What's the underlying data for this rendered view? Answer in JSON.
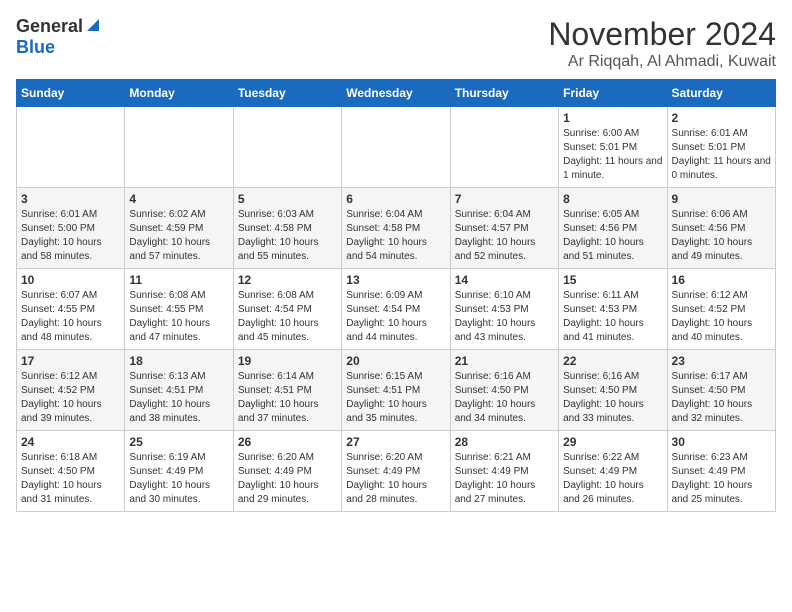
{
  "header": {
    "logo_general": "General",
    "logo_blue": "Blue",
    "month_title": "November 2024",
    "location": "Ar Riqqah, Al Ahmadi, Kuwait"
  },
  "weekdays": [
    "Sunday",
    "Monday",
    "Tuesday",
    "Wednesday",
    "Thursday",
    "Friday",
    "Saturday"
  ],
  "weeks": [
    [
      {
        "day": "",
        "sunrise": "",
        "sunset": "",
        "daylight": ""
      },
      {
        "day": "",
        "sunrise": "",
        "sunset": "",
        "daylight": ""
      },
      {
        "day": "",
        "sunrise": "",
        "sunset": "",
        "daylight": ""
      },
      {
        "day": "",
        "sunrise": "",
        "sunset": "",
        "daylight": ""
      },
      {
        "day": "",
        "sunrise": "",
        "sunset": "",
        "daylight": ""
      },
      {
        "day": "1",
        "sunrise": "Sunrise: 6:00 AM",
        "sunset": "Sunset: 5:01 PM",
        "daylight": "Daylight: 11 hours and 1 minute."
      },
      {
        "day": "2",
        "sunrise": "Sunrise: 6:01 AM",
        "sunset": "Sunset: 5:01 PM",
        "daylight": "Daylight: 11 hours and 0 minutes."
      }
    ],
    [
      {
        "day": "3",
        "sunrise": "Sunrise: 6:01 AM",
        "sunset": "Sunset: 5:00 PM",
        "daylight": "Daylight: 10 hours and 58 minutes."
      },
      {
        "day": "4",
        "sunrise": "Sunrise: 6:02 AM",
        "sunset": "Sunset: 4:59 PM",
        "daylight": "Daylight: 10 hours and 57 minutes."
      },
      {
        "day": "5",
        "sunrise": "Sunrise: 6:03 AM",
        "sunset": "Sunset: 4:58 PM",
        "daylight": "Daylight: 10 hours and 55 minutes."
      },
      {
        "day": "6",
        "sunrise": "Sunrise: 6:04 AM",
        "sunset": "Sunset: 4:58 PM",
        "daylight": "Daylight: 10 hours and 54 minutes."
      },
      {
        "day": "7",
        "sunrise": "Sunrise: 6:04 AM",
        "sunset": "Sunset: 4:57 PM",
        "daylight": "Daylight: 10 hours and 52 minutes."
      },
      {
        "day": "8",
        "sunrise": "Sunrise: 6:05 AM",
        "sunset": "Sunset: 4:56 PM",
        "daylight": "Daylight: 10 hours and 51 minutes."
      },
      {
        "day": "9",
        "sunrise": "Sunrise: 6:06 AM",
        "sunset": "Sunset: 4:56 PM",
        "daylight": "Daylight: 10 hours and 49 minutes."
      }
    ],
    [
      {
        "day": "10",
        "sunrise": "Sunrise: 6:07 AM",
        "sunset": "Sunset: 4:55 PM",
        "daylight": "Daylight: 10 hours and 48 minutes."
      },
      {
        "day": "11",
        "sunrise": "Sunrise: 6:08 AM",
        "sunset": "Sunset: 4:55 PM",
        "daylight": "Daylight: 10 hours and 47 minutes."
      },
      {
        "day": "12",
        "sunrise": "Sunrise: 6:08 AM",
        "sunset": "Sunset: 4:54 PM",
        "daylight": "Daylight: 10 hours and 45 minutes."
      },
      {
        "day": "13",
        "sunrise": "Sunrise: 6:09 AM",
        "sunset": "Sunset: 4:54 PM",
        "daylight": "Daylight: 10 hours and 44 minutes."
      },
      {
        "day": "14",
        "sunrise": "Sunrise: 6:10 AM",
        "sunset": "Sunset: 4:53 PM",
        "daylight": "Daylight: 10 hours and 43 minutes."
      },
      {
        "day": "15",
        "sunrise": "Sunrise: 6:11 AM",
        "sunset": "Sunset: 4:53 PM",
        "daylight": "Daylight: 10 hours and 41 minutes."
      },
      {
        "day": "16",
        "sunrise": "Sunrise: 6:12 AM",
        "sunset": "Sunset: 4:52 PM",
        "daylight": "Daylight: 10 hours and 40 minutes."
      }
    ],
    [
      {
        "day": "17",
        "sunrise": "Sunrise: 6:12 AM",
        "sunset": "Sunset: 4:52 PM",
        "daylight": "Daylight: 10 hours and 39 minutes."
      },
      {
        "day": "18",
        "sunrise": "Sunrise: 6:13 AM",
        "sunset": "Sunset: 4:51 PM",
        "daylight": "Daylight: 10 hours and 38 minutes."
      },
      {
        "day": "19",
        "sunrise": "Sunrise: 6:14 AM",
        "sunset": "Sunset: 4:51 PM",
        "daylight": "Daylight: 10 hours and 37 minutes."
      },
      {
        "day": "20",
        "sunrise": "Sunrise: 6:15 AM",
        "sunset": "Sunset: 4:51 PM",
        "daylight": "Daylight: 10 hours and 35 minutes."
      },
      {
        "day": "21",
        "sunrise": "Sunrise: 6:16 AM",
        "sunset": "Sunset: 4:50 PM",
        "daylight": "Daylight: 10 hours and 34 minutes."
      },
      {
        "day": "22",
        "sunrise": "Sunrise: 6:16 AM",
        "sunset": "Sunset: 4:50 PM",
        "daylight": "Daylight: 10 hours and 33 minutes."
      },
      {
        "day": "23",
        "sunrise": "Sunrise: 6:17 AM",
        "sunset": "Sunset: 4:50 PM",
        "daylight": "Daylight: 10 hours and 32 minutes."
      }
    ],
    [
      {
        "day": "24",
        "sunrise": "Sunrise: 6:18 AM",
        "sunset": "Sunset: 4:50 PM",
        "daylight": "Daylight: 10 hours and 31 minutes."
      },
      {
        "day": "25",
        "sunrise": "Sunrise: 6:19 AM",
        "sunset": "Sunset: 4:49 PM",
        "daylight": "Daylight: 10 hours and 30 minutes."
      },
      {
        "day": "26",
        "sunrise": "Sunrise: 6:20 AM",
        "sunset": "Sunset: 4:49 PM",
        "daylight": "Daylight: 10 hours and 29 minutes."
      },
      {
        "day": "27",
        "sunrise": "Sunrise: 6:20 AM",
        "sunset": "Sunset: 4:49 PM",
        "daylight": "Daylight: 10 hours and 28 minutes."
      },
      {
        "day": "28",
        "sunrise": "Sunrise: 6:21 AM",
        "sunset": "Sunset: 4:49 PM",
        "daylight": "Daylight: 10 hours and 27 minutes."
      },
      {
        "day": "29",
        "sunrise": "Sunrise: 6:22 AM",
        "sunset": "Sunset: 4:49 PM",
        "daylight": "Daylight: 10 hours and 26 minutes."
      },
      {
        "day": "30",
        "sunrise": "Sunrise: 6:23 AM",
        "sunset": "Sunset: 4:49 PM",
        "daylight": "Daylight: 10 hours and 25 minutes."
      }
    ]
  ]
}
